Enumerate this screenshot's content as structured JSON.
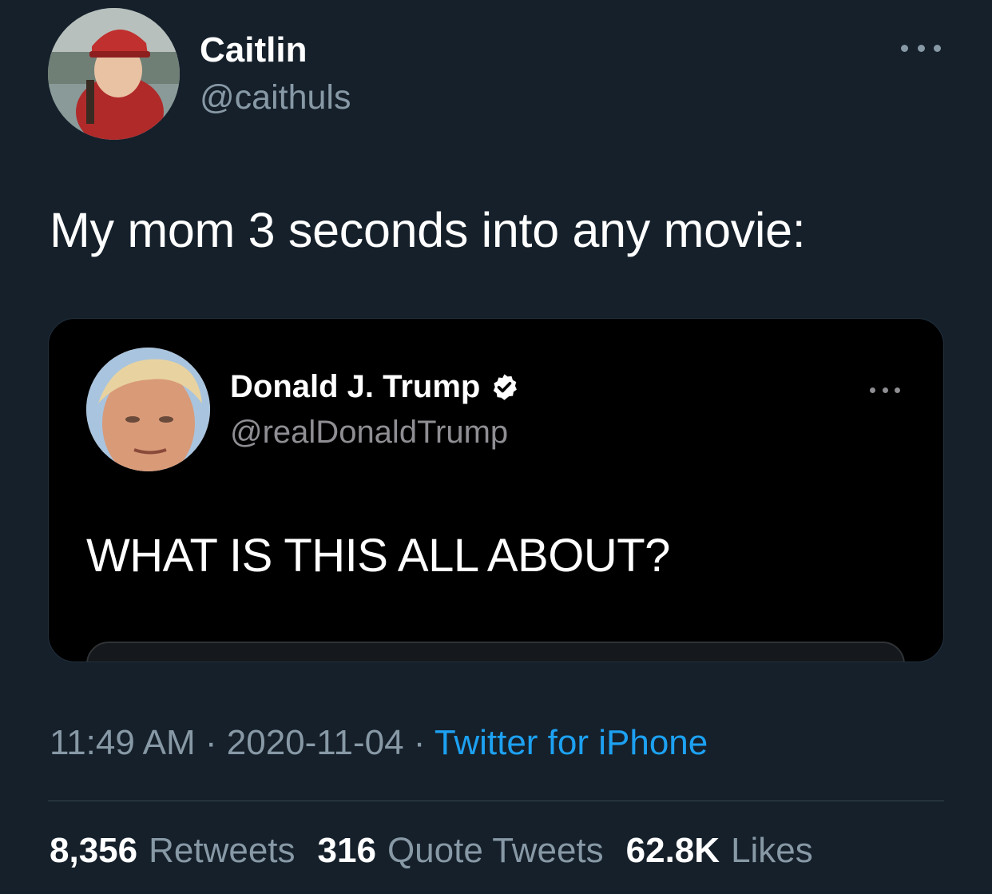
{
  "author": {
    "name": "Caitlin",
    "handle": "@caithuls"
  },
  "tweet_text": "My mom 3 seconds into any movie:",
  "quoted": {
    "name": "Donald J. Trump",
    "handle": "@realDonaldTrump",
    "text": "WHAT IS THIS ALL ABOUT?",
    "verified_icon": "verified-badge-icon"
  },
  "meta": {
    "time": "11:49 AM",
    "sep1": " · ",
    "date": "2020-11-04",
    "sep2": " · ",
    "source": "Twitter for iPhone"
  },
  "stats": {
    "retweets_count": "8,356",
    "retweets_label": "Retweets",
    "quotes_count": "316",
    "quotes_label": "Quote Tweets",
    "likes_count": "62.8K",
    "likes_label": "Likes"
  },
  "colors": {
    "background": "#15202b",
    "secondary_text": "#8899a6",
    "link": "#1da1f2"
  }
}
